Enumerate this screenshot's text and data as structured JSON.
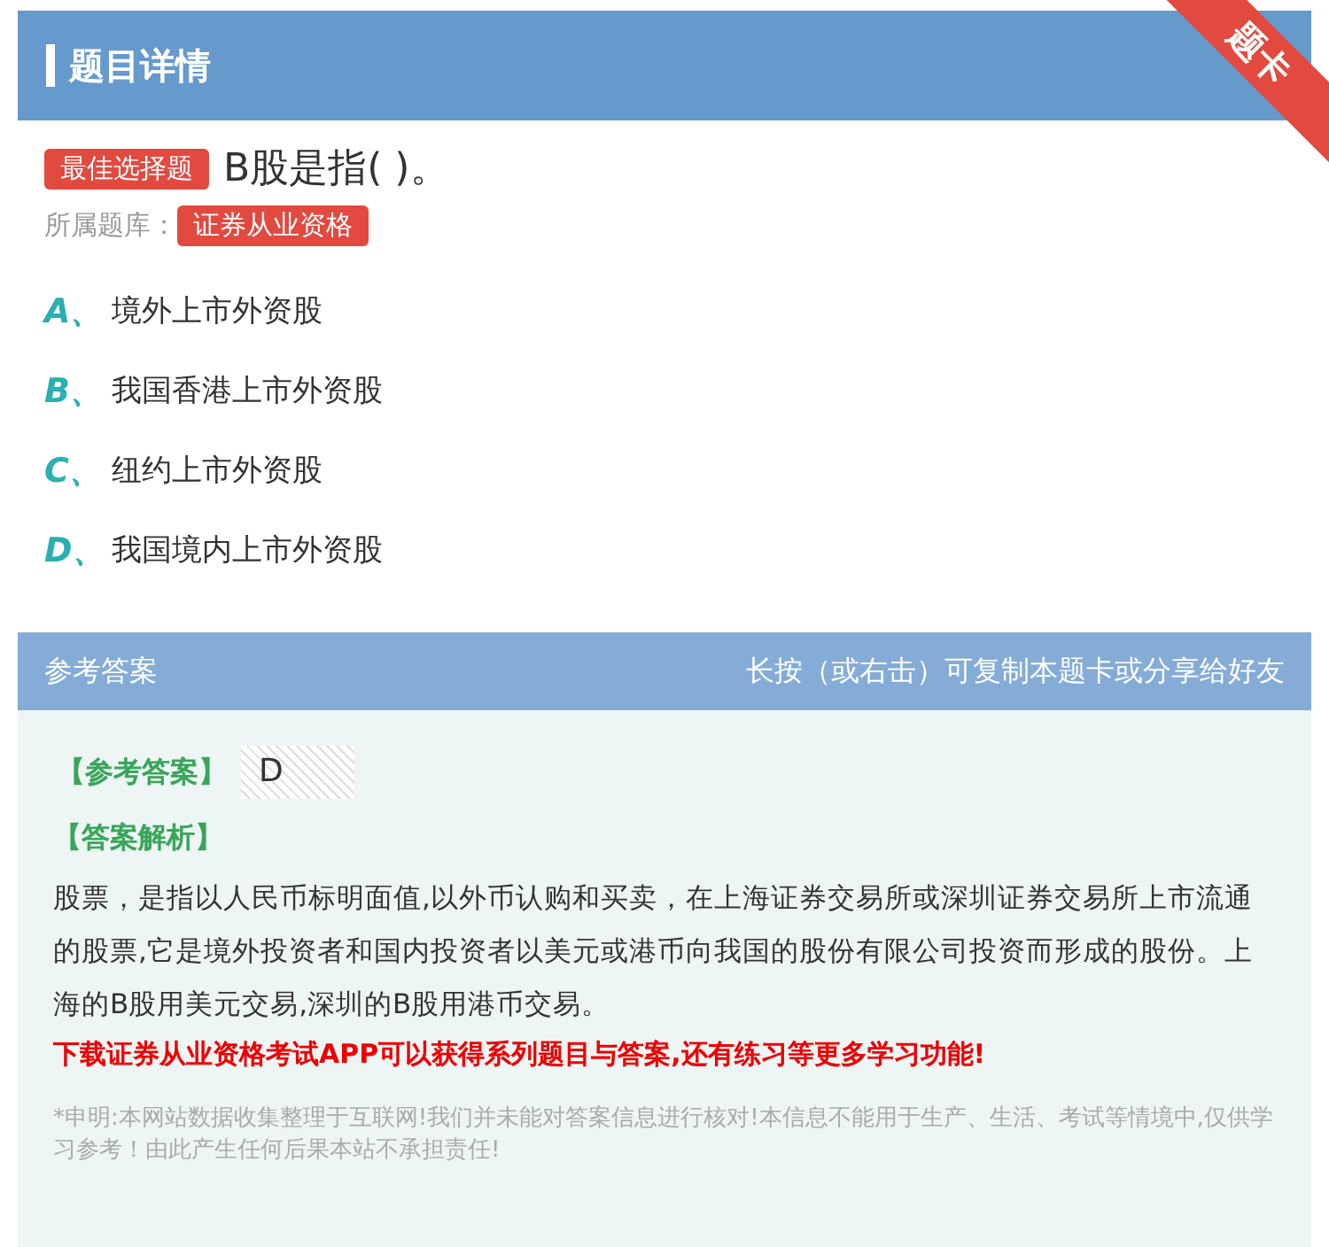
{
  "header": {
    "title": "题目详情",
    "ribbon": "题卡"
  },
  "question": {
    "type_badge": "最佳选择题",
    "text": "B股是指( )。",
    "bank_label": "所属题库：",
    "bank": "证券从业资格"
  },
  "options": [
    {
      "letter": "A、",
      "text": "境外上市外资股"
    },
    {
      "letter": "B、",
      "text": "我国香港上市外资股"
    },
    {
      "letter": "C、",
      "text": "纽约上市外资股"
    },
    {
      "letter": "D、",
      "text": "我国境内上市外资股"
    }
  ],
  "answer_section": {
    "title": "参考答案",
    "hint": "长按（或右击）可复制本题卡或分享给好友",
    "answer_label": "【参考答案】",
    "answer": "D",
    "analysis_label": "【答案解析】",
    "analysis": "股票，是指以人民币标明面值,以外币认购和买卖，在上海证券交易所或深圳证券交易所上市流通的股票,它是境外投资者和国内投资者以美元或港币向我国的股份有限公司投资而形成的股份。上海的B股用美元交易,深圳的B股用港币交易。",
    "promo": "下载证券从业资格考试APP可以获得系列题目与答案,还有练习等更多学习功能!",
    "disclaimer": "*申明:本网站数据收集整理于互联网!我们并未能对答案信息进行核对!本信息不能用于生产、生活、考试等情境中,仅供学习参考！由此产生任何后果本站不承担责任!"
  }
}
